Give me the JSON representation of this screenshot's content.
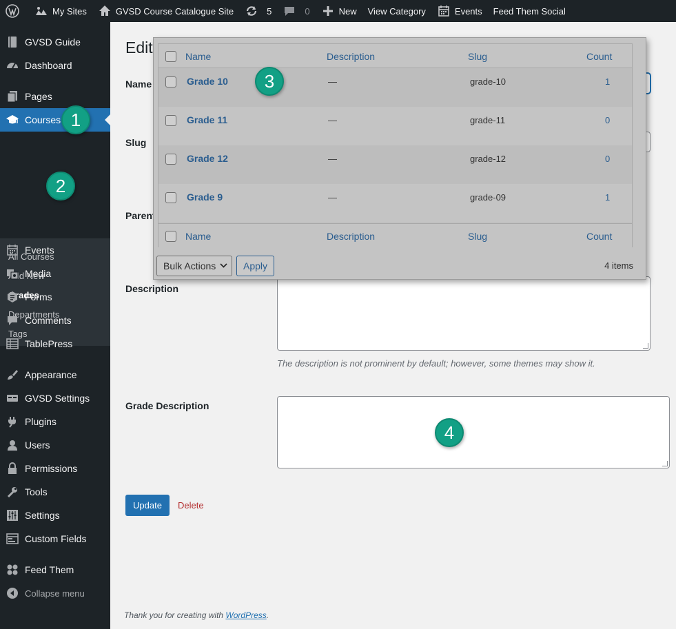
{
  "adminbar": {
    "items": [
      {
        "label": "",
        "icon": "wordpress-logo-icon"
      },
      {
        "label": "My Sites",
        "icon": "my-sites-icon"
      },
      {
        "label": "GVSD Course Catalogue Site",
        "icon": "home-icon"
      },
      {
        "label": "",
        "count": "5",
        "icon": "updates-icon"
      },
      {
        "label": "",
        "count": "0",
        "icon": "comments-icon"
      },
      {
        "label": "New",
        "icon": "plus-icon"
      },
      {
        "label": "View Category"
      },
      {
        "label": "Events",
        "icon": "calendar-icon"
      },
      {
        "label": "Feed Them Social"
      }
    ]
  },
  "sidebar": {
    "items": [
      {
        "label": "GVSD Guide",
        "icon": "book-icon"
      },
      {
        "label": "Dashboard",
        "icon": "dashboard-icon"
      },
      {
        "label": "Pages",
        "icon": "pages-icon"
      },
      {
        "label": "Courses",
        "icon": "graduation-cap-icon",
        "active": true
      },
      {
        "label": "Events",
        "icon": "calendar-icon"
      },
      {
        "label": "Media",
        "icon": "media-icon"
      },
      {
        "label": "Forms",
        "icon": "forms-icon"
      },
      {
        "label": "Comments",
        "icon": "comment-icon"
      },
      {
        "label": "TablePress",
        "icon": "table-icon"
      },
      {
        "label": "Appearance",
        "icon": "brush-icon"
      },
      {
        "label": "GVSD Settings",
        "icon": "settings-card-icon"
      },
      {
        "label": "Plugins",
        "icon": "plugin-icon"
      },
      {
        "label": "Users",
        "icon": "user-icon"
      },
      {
        "label": "Permissions",
        "icon": "lock-icon"
      },
      {
        "label": "Tools",
        "icon": "wrench-icon"
      },
      {
        "label": "Settings",
        "icon": "sliders-icon"
      },
      {
        "label": "Custom Fields",
        "icon": "fields-icon"
      },
      {
        "label": "Feed Them",
        "icon": "feed-icon"
      },
      {
        "label": "Collapse menu",
        "icon": "collapse-icon"
      }
    ],
    "submenu": [
      {
        "label": "All Courses"
      },
      {
        "label": "Add New"
      },
      {
        "label": "Grades",
        "current": true
      },
      {
        "label": "Departments"
      },
      {
        "label": "Tags"
      }
    ]
  },
  "main": {
    "title": "Edit",
    "labels": {
      "name": "Name",
      "slug": "Slug",
      "parent": "Parent",
      "description": "Description",
      "grade_description": "Grade Description"
    },
    "description_hint": "The description is not prominent by default; however, some themes may show it.",
    "update_label": "Update",
    "delete_label": "Delete",
    "footer_text": "Thank you for creating with ",
    "footer_link": "WordPress",
    "footer_end": "."
  },
  "overlay": {
    "columns": [
      "Name",
      "Description",
      "Slug",
      "Count"
    ],
    "rows": [
      {
        "name": "Grade 10",
        "description": "—",
        "slug": "grade-10",
        "count": "1"
      },
      {
        "name": "Grade 11",
        "description": "—",
        "slug": "grade-11",
        "count": "0"
      },
      {
        "name": "Grade 12",
        "description": "—",
        "slug": "grade-12",
        "count": "0"
      },
      {
        "name": "Grade 9",
        "description": "—",
        "slug": "grade-09",
        "count": "1"
      }
    ],
    "bulk_actions": "Bulk Actions",
    "apply": "Apply",
    "items_count": "4 items"
  },
  "callouts": [
    "1",
    "2",
    "3",
    "4"
  ],
  "colors": {
    "adminbar_bg": "#1d2327",
    "accent": "#2271b1",
    "callout": "#12a085",
    "delete": "#b32d2e"
  }
}
